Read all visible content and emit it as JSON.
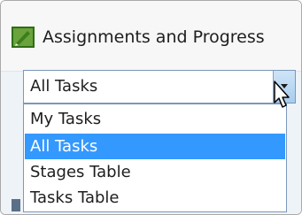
{
  "window": {
    "title": "Assignments and Progress",
    "icon": "pencil-app-icon"
  },
  "selector": {
    "selected_value": "All Tasks",
    "arrow_icon": "chevron-down-icon"
  },
  "dropdown": {
    "options": [
      {
        "label": "My Tasks",
        "selected": false
      },
      {
        "label": "All Tasks",
        "selected": true
      },
      {
        "label": "Stages Table",
        "selected": false
      },
      {
        "label": "Tasks Table",
        "selected": false
      }
    ]
  },
  "colors": {
    "highlight": "#3399ff",
    "icon_green": "#6aa33a",
    "border": "#7a98bc"
  }
}
